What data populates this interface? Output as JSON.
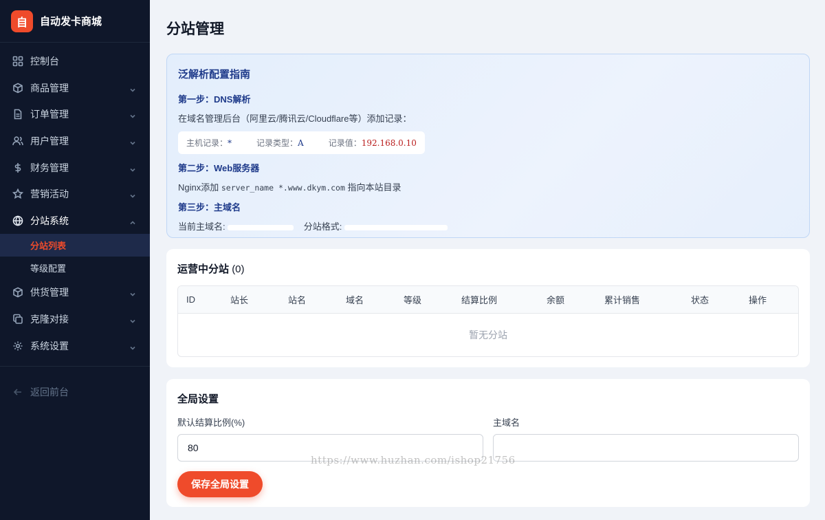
{
  "brand": {
    "logo": "自",
    "name": "自动发卡商城"
  },
  "sidebar": {
    "items": [
      {
        "label": "控制台",
        "icon": "dashboard-icon"
      },
      {
        "label": "商品管理",
        "icon": "box-icon"
      },
      {
        "label": "订单管理",
        "icon": "document-icon"
      },
      {
        "label": "用户管理",
        "icon": "users-icon"
      },
      {
        "label": "财务管理",
        "icon": "dollar-icon"
      },
      {
        "label": "营销活动",
        "icon": "star-icon"
      },
      {
        "label": "分站系统",
        "icon": "globe-icon"
      }
    ],
    "sub_items": [
      {
        "label": "分站列表",
        "active": true
      },
      {
        "label": "等级配置",
        "active": false
      }
    ],
    "items_after": [
      {
        "label": "供货管理",
        "icon": "box-icon"
      },
      {
        "label": "克隆对接",
        "icon": "copy-icon"
      },
      {
        "label": "系统设置",
        "icon": "gear-icon"
      }
    ],
    "back_label": "返回前台"
  },
  "page": {
    "title": "分站管理"
  },
  "guide": {
    "title": "泛解析配置指南",
    "step1_title": "第一步：DNS解析",
    "step1_text": "在域名管理后台（阿里云/腾讯云/Cloudflare等）添加记录：",
    "record_host_label": "主机记录：",
    "record_host_value": "*",
    "record_type_label": "记录类型：",
    "record_type_value": "A",
    "record_value_label": "记录值：",
    "record_value_value": "192.168.0.10",
    "step2_title": "第二步：Web服务器",
    "step2_prefix": "Nginx添加",
    "step2_code": "server_name *.www.dkym.com",
    "step2_suffix": "指向本站目录",
    "step3_title": "第三步：主域名",
    "main_domain_label": "当前主域名:",
    "sub_format_label": "分站格式:"
  },
  "stations": {
    "title": "运营中分站",
    "count": "(0)",
    "columns": [
      "ID",
      "站长",
      "站名",
      "域名",
      "等级",
      "结算比例",
      "余额",
      "累计销售",
      "状态",
      "操作"
    ],
    "empty_text": "暂无分站"
  },
  "settings": {
    "title": "全局设置",
    "ratio_label": "默认结算比例(%)",
    "ratio_value": "80",
    "domain_label": "主域名",
    "domain_value": "",
    "save_label": "保存全局设置"
  },
  "watermark": "https://www.huzhan.com/ishop21756",
  "colors": {
    "accent": "#ef4b2b",
    "sidebar_bg": "#0f172a",
    "guide_title": "#1e3a8a"
  }
}
